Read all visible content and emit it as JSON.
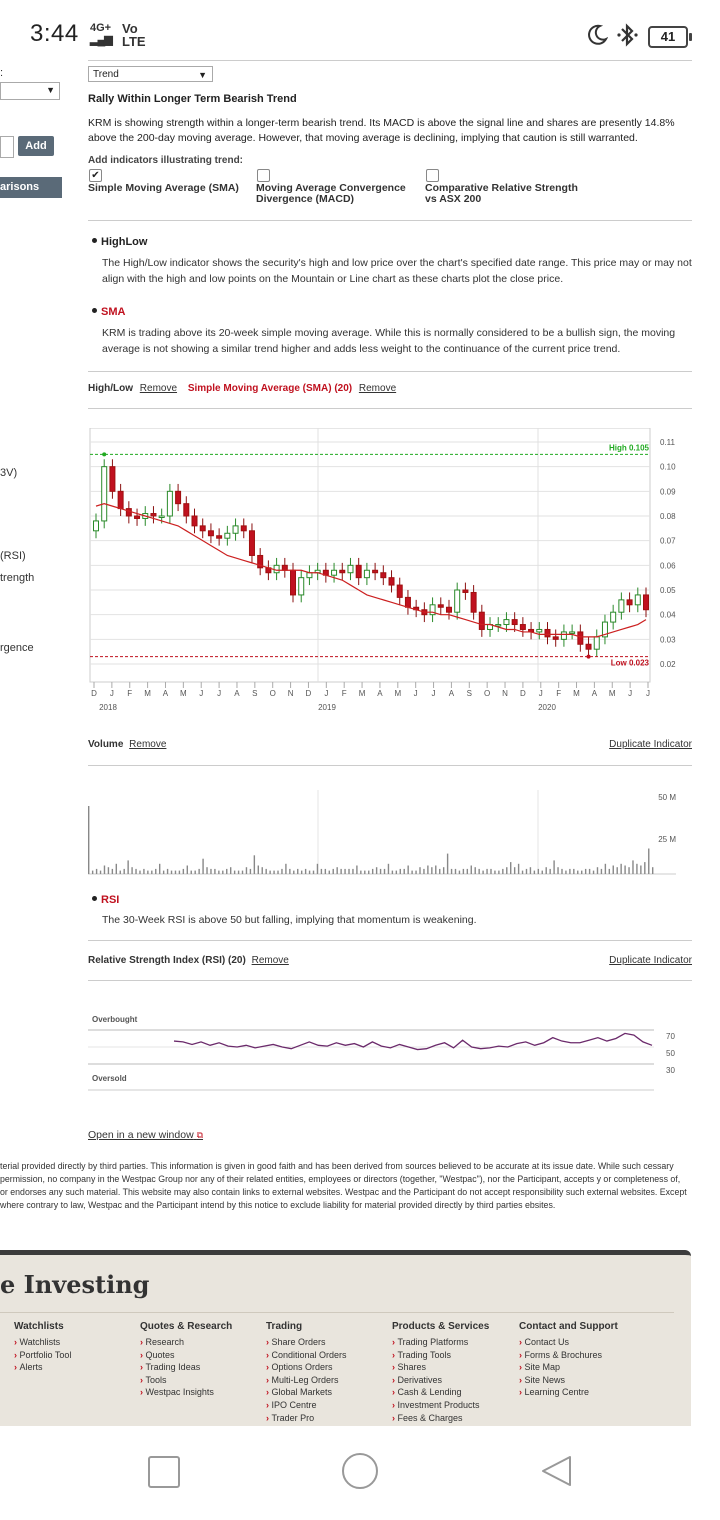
{
  "status_bar": {
    "time": "3:44",
    "network": "4G+",
    "volte": "Vo LTE",
    "battery": "41"
  },
  "left_panel": {
    "add_label": "Add",
    "comparisons_label": "arisons",
    "fragments": [
      ":",
      "3V)",
      "(RSI)",
      "trength",
      "rgence"
    ]
  },
  "trend": {
    "select_value": "Trend",
    "title": "Rally Within Longer Term Bearish Trend",
    "description": "KRM is showing strength within a longer-term bearish trend. Its MACD is above the signal line and shares are presently 14.8% above the 200-day moving average. However, that moving average is declining, implying that caution is still warranted.",
    "add_label": "Add indicators illustrating trend:",
    "options": [
      {
        "label": "Simple Moving Average (SMA)",
        "checked": true
      },
      {
        "label": "Moving Average Convergence Divergence (MACD)",
        "checked": false
      },
      {
        "label": "Comparative Relative Strength vs ASX 200",
        "checked": false
      }
    ]
  },
  "highlow_info": {
    "title": "HighLow",
    "desc": "The High/Low indicator shows the security's high and low price over the chart's specified date range. This price may or may not align with the high and low points on the Mountain or Line chart as these charts plot the close price."
  },
  "sma_info": {
    "title": "SMA",
    "desc": "KRM is trading above its 20-week simple moving average. While this is normally considered to be a bullish sign, the moving average is not showing a similar trend higher and adds less weight to the continuance of the current price trend."
  },
  "indicator_bar": {
    "highlow": "High/Low",
    "remove": "Remove",
    "sma": "Simple Moving Average (SMA) (20)"
  },
  "chart_data": [
    {
      "type": "candlestick",
      "title": "",
      "yticks": [
        "0.11",
        "0.10",
        "0.09",
        "0.08",
        "0.07",
        "0.06",
        "0.05",
        "0.04",
        "0.03",
        "0.02"
      ],
      "ylim": [
        0.02,
        0.11
      ],
      "xticks": [
        "D",
        "J",
        "F",
        "M",
        "A",
        "M",
        "J",
        "J",
        "A",
        "S",
        "O",
        "N",
        "D",
        "J",
        "F",
        "M",
        "A",
        "M",
        "J",
        "J",
        "A",
        "S",
        "O",
        "N",
        "D",
        "J",
        "F",
        "M",
        "A",
        "M",
        "J",
        "J"
      ],
      "years": [
        "2018",
        "2019",
        "2020"
      ],
      "high_label": "High 0.105",
      "low_label": "Low 0.023",
      "high": 0.105,
      "low": 0.023,
      "closes": [
        0.078,
        0.1,
        0.09,
        0.083,
        0.08,
        0.079,
        0.081,
        0.08,
        0.08,
        0.09,
        0.085,
        0.08,
        0.076,
        0.074,
        0.072,
        0.071,
        0.073,
        0.076,
        0.074,
        0.064,
        0.059,
        0.057,
        0.06,
        0.058,
        0.048,
        0.055,
        0.057,
        0.058,
        0.056,
        0.058,
        0.057,
        0.06,
        0.055,
        0.058,
        0.057,
        0.055,
        0.052,
        0.047,
        0.043,
        0.042,
        0.04,
        0.044,
        0.043,
        0.041,
        0.05,
        0.049,
        0.041,
        0.034,
        0.036,
        0.036,
        0.038,
        0.036,
        0.034,
        0.033,
        0.034,
        0.031,
        0.03,
        0.033,
        0.033,
        0.028,
        0.026,
        0.031,
        0.037,
        0.041,
        0.046,
        0.044,
        0.048,
        0.042
      ],
      "sma": [
        0.084,
        0.085,
        0.084,
        0.083,
        0.082,
        0.081,
        0.08,
        0.079,
        0.078,
        0.077,
        0.076,
        0.074,
        0.072,
        0.07,
        0.068,
        0.066,
        0.064,
        0.063,
        0.062,
        0.061,
        0.06,
        0.059,
        0.058,
        0.058,
        0.058,
        0.058,
        0.057,
        0.057,
        0.056,
        0.055,
        0.054,
        0.052,
        0.05,
        0.048,
        0.047,
        0.046,
        0.045,
        0.044,
        0.043,
        0.042,
        0.041,
        0.041,
        0.04,
        0.04,
        0.039,
        0.038,
        0.037,
        0.036,
        0.036,
        0.035,
        0.034,
        0.034,
        0.033,
        0.033,
        0.032,
        0.032,
        0.032,
        0.032,
        0.032,
        0.031,
        0.031,
        0.031,
        0.032,
        0.033,
        0.034,
        0.035,
        0.036,
        0.038
      ]
    },
    {
      "type": "bar",
      "title": "Volume",
      "yticks": [
        "50 M",
        "25 M"
      ],
      "values": [
        40,
        2,
        3,
        2,
        5,
        4,
        3,
        6,
        2,
        3,
        8,
        4,
        3,
        2,
        3,
        2,
        2,
        3,
        6,
        2,
        3,
        2,
        2,
        2,
        3,
        5,
        2,
        2,
        3,
        9,
        4,
        3,
        3,
        2,
        2,
        3,
        4,
        2,
        2,
        2,
        4,
        3,
        11,
        5,
        4,
        3,
        2,
        2,
        2,
        3,
        6,
        3,
        2,
        3,
        2,
        3,
        2,
        2,
        6,
        3,
        3,
        2,
        3,
        4,
        3,
        3,
        3,
        3,
        5,
        2,
        2,
        2,
        3,
        4,
        3,
        3,
        6,
        2,
        2,
        3,
        3,
        5,
        2,
        2,
        4,
        3,
        5,
        4,
        5,
        3,
        4,
        12,
        3,
        3,
        2,
        3,
        3,
        5,
        4,
        3,
        2,
        3,
        3,
        2,
        2,
        3,
        4,
        7,
        4,
        6,
        2,
        3,
        4,
        2,
        3,
        2,
        4,
        3,
        8,
        4,
        3,
        2,
        3,
        3,
        2,
        2,
        3,
        3,
        2,
        4,
        3,
        6,
        3,
        5,
        4,
        6,
        5,
        4,
        8,
        6,
        5,
        7,
        15,
        4
      ]
    },
    {
      "type": "line",
      "title": "Relative Strength Index (RSI) (20)",
      "yticks": [
        "70",
        "50",
        "30"
      ],
      "ylim": [
        20,
        80
      ],
      "bands": [
        "Overbought",
        "Oversold"
      ],
      "values": [
        57,
        56,
        53,
        56,
        52,
        55,
        51,
        50,
        52,
        49,
        51,
        53,
        50,
        48,
        52,
        56,
        52,
        51,
        55,
        52,
        54,
        50,
        56,
        51,
        49,
        53,
        50,
        47,
        48,
        52,
        55,
        49,
        58,
        50,
        48,
        49,
        51,
        50,
        54,
        56,
        52,
        55,
        61,
        57,
        55,
        55,
        58,
        61,
        57,
        60,
        66,
        64,
        56,
        52
      ]
    }
  ],
  "volume_bar": {
    "title": "Volume",
    "remove": "Remove",
    "duplicate": "Duplicate Indicator"
  },
  "rsi_info": {
    "title": "RSI",
    "desc": "The 30-Week RSI is above 50 but falling, implying that momentum is weakening."
  },
  "rsi_bar": {
    "title": "Relative Strength Index (RSI) (20)",
    "remove": "Remove",
    "duplicate": "Duplicate Indicator"
  },
  "open_new_window": "Open in a new window",
  "disclaimer": "terial provided directly by third parties. This information is given in good faith and has been derived from sources believed to be accurate at its issue date. While such cessary permission, no company in the Westpac Group nor any of their related entities, employees or directors (together, \"Westpac\"), nor the Participant, accepts y or completeness of, or endorses any such material. This website may also contain links to external websites. Westpac and the Participant do not accept responsibility such external websites. Except where contrary to law, Westpac and the Participant intend by this notice to exclude liability for material provided directly by third parties ebsites.",
  "footer": {
    "title": "e Investing",
    "columns": [
      {
        "title": "Watchlists",
        "items": [
          "Watchlists",
          "Portfolio Tool",
          "Alerts"
        ]
      },
      {
        "title": "Quotes & Research",
        "items": [
          "Research",
          "Quotes",
          "Trading Ideas",
          "Tools",
          "Westpac Insights"
        ]
      },
      {
        "title": "Trading",
        "items": [
          "Share Orders",
          "Conditional Orders",
          "Options Orders",
          "Multi-Leg Orders",
          "Global Markets",
          "IPO Centre",
          "Trader Pro"
        ]
      },
      {
        "title": "Products & Services",
        "items": [
          "Trading Platforms",
          "Trading Tools",
          "Shares",
          "Derivatives",
          "Cash & Lending",
          "Investment Products",
          "Fees & Charges"
        ]
      },
      {
        "title": "Contact and Support",
        "items": [
          "Contact Us",
          "Forms & Brochures",
          "Site Map",
          "Site News",
          "Learning Centre"
        ]
      }
    ]
  },
  "colors": {
    "accent_red": "#c0111f",
    "high_green": "#22aa22",
    "sma_red": "#cc2020",
    "rsi_purple": "#6b2a6b"
  }
}
